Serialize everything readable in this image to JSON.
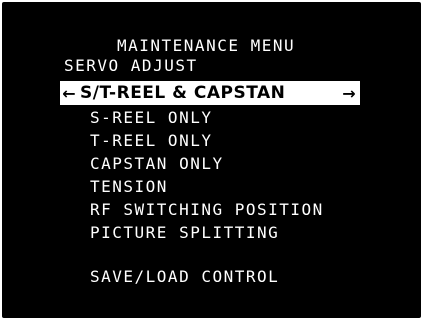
{
  "menu": {
    "title": "MAINTENANCE MENU",
    "section": "SERVO ADJUST",
    "selected": {
      "left_arrow": "←",
      "label": "S/T-REEL & CAPSTAN",
      "right_arrow": "→"
    },
    "items": [
      "S-REEL ONLY",
      "T-REEL ONLY",
      "CAPSTAN ONLY",
      "TENSION",
      "RF SWITCHING POSITION",
      "PICTURE SPLITTING"
    ],
    "footer_item": "SAVE/LOAD CONTROL"
  }
}
